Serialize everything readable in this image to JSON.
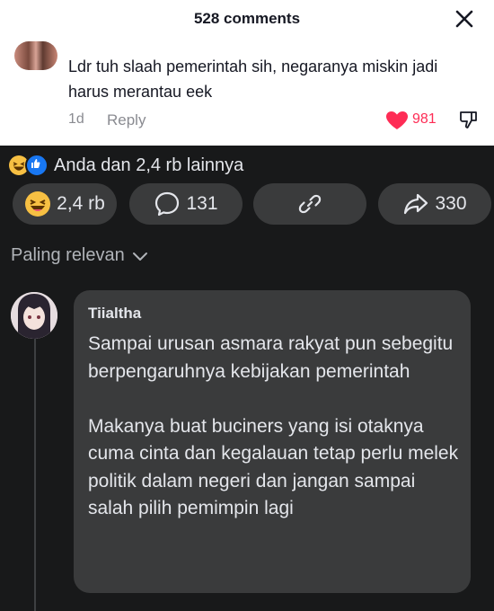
{
  "header": {
    "title": "528 comments"
  },
  "top_comment": {
    "text": "Ldr tuh slaah pemerintah sih, negaranya miskin jadi harus merantau eek",
    "time": "1d",
    "reply_label": "Reply",
    "likes": "981"
  },
  "reactions": {
    "summary": "Anda dan 2,4 rb lainnya"
  },
  "actions": {
    "react_count": "2,4 rb",
    "comment_count": "131",
    "share_count": "330"
  },
  "sort": {
    "label": "Paling relevan"
  },
  "comment": {
    "author": "Tiialtha",
    "body": "Sampai urusan asmara rakyat pun sebegitu berpengaruhnya kebijakan pemerintah\n\nMakanya buat buciners yang isi otaknya cuma cinta dan kegalauan tetap perlu melek politik dalam negeri dan jangan sampai salah pilih pemimpin lagi"
  },
  "colors": {
    "like_red": "#fe2c55",
    "dark_bg": "#18191a",
    "pill_bg": "#3a3b3c"
  }
}
